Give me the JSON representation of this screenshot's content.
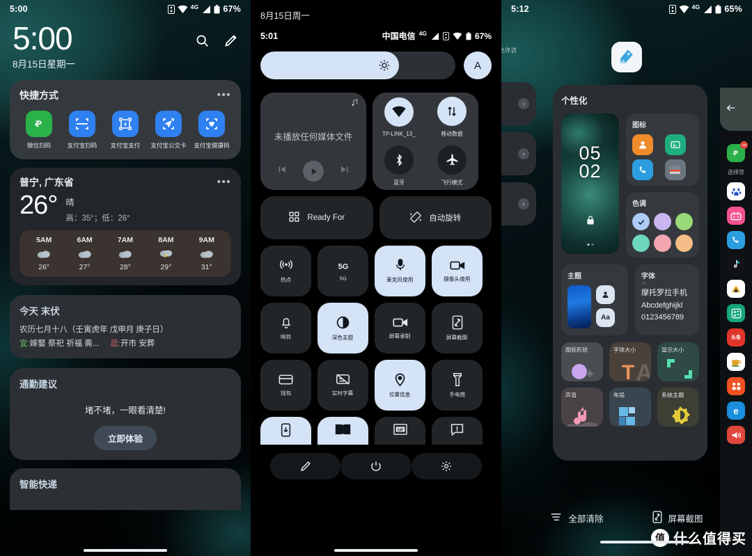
{
  "panel1": {
    "name": "lockscreen-at-a-glance",
    "status": {
      "time": "5:00",
      "battery": "67%",
      "network": "4G"
    },
    "clock": {
      "time": "5:00",
      "date": "8月15日星期一"
    },
    "actions": {
      "search": "search-icon",
      "edit": "edit-icon"
    },
    "shortcuts": {
      "title": "快捷方式",
      "menu": "•••",
      "items": [
        {
          "label": "微信扫码",
          "color": "#2bb14a",
          "icon": "wechat-scan-icon"
        },
        {
          "label": "支付宝扫码",
          "color": "#2f80f0",
          "icon": "alipay-scan-icon"
        },
        {
          "label": "支付宝支付",
          "color": "#2f80f0",
          "icon": "alipay-pay-icon"
        },
        {
          "label": "支付宝公交卡",
          "color": "#2f80f0",
          "icon": "alipay-transit-icon"
        },
        {
          "label": "支付宝健康码",
          "color": "#2f80f0",
          "icon": "alipay-health-icon"
        }
      ]
    },
    "weather": {
      "location": "普宁, 广东省",
      "menu": "•••",
      "temp": "26°",
      "condition": "晴",
      "highlow": "高：35°；低：26°",
      "hours": [
        {
          "time": "5AM",
          "icon": "cloud",
          "temp": "26°"
        },
        {
          "time": "6AM",
          "icon": "cloud",
          "temp": "27°"
        },
        {
          "time": "7AM",
          "icon": "cloud",
          "temp": "28°"
        },
        {
          "time": "8AM",
          "icon": "thunder",
          "temp": "29°"
        },
        {
          "time": "9AM",
          "icon": "cloud",
          "temp": "31°"
        }
      ]
    },
    "almanac": {
      "title": "今天 末伏",
      "lunar": "农历七月十八（壬寅虎年 戊申月 庚子日）",
      "yi_label": "宜:",
      "yi_text": "嫁娶 祭祀 祈福 斋...",
      "ji_label": "忌:",
      "ji_text": "开市 安葬"
    },
    "commute": {
      "title": "通勤建议",
      "text": "堵不堵，一眼看清楚!",
      "button": "立即体验"
    },
    "express": {
      "title": "智能快递"
    }
  },
  "panel2": {
    "name": "quick-settings-shade",
    "date": "8月15日周一",
    "status": {
      "time": "5:01",
      "carrier": "中国电信",
      "network": "4G",
      "battery": "67%"
    },
    "brightness": {
      "value": 71,
      "auto_label": "A"
    },
    "media": {
      "text": "未播放任何媒体文件",
      "prev": "previous-icon",
      "play": "play-icon",
      "next": "next-icon"
    },
    "toggles": [
      {
        "label": "TP-LINK_13_",
        "icon": "wifi-icon",
        "on": true
      },
      {
        "label": "移动数据",
        "icon": "mobile-data-icon",
        "on": true
      },
      {
        "label": "蓝牙",
        "icon": "bluetooth-icon",
        "on": false
      },
      {
        "label": "飞行模式",
        "icon": "airplane-icon",
        "on": false
      }
    ],
    "wide_tiles": [
      {
        "label": "Ready For",
        "icon": "grid-icon"
      },
      {
        "label": "自动旋转",
        "icon": "auto-rotate-icon"
      }
    ],
    "tiles": [
      {
        "label": "热点",
        "icon": "hotspot-icon",
        "active": false
      },
      {
        "label": "5G",
        "icon": "5g-icon",
        "active": false
      },
      {
        "label": "麦克风使用",
        "icon": "microphone-icon",
        "active": true
      },
      {
        "label": "摄像头使用",
        "icon": "camera-icon",
        "active": true
      },
      {
        "label": "响铃",
        "icon": "bell-icon",
        "active": false
      },
      {
        "label": "深色主题",
        "icon": "dark-theme-icon",
        "active": true
      },
      {
        "label": "屏幕录制",
        "icon": "screen-record-icon",
        "active": false
      },
      {
        "label": "屏幕截图",
        "icon": "screenshot-icon",
        "active": false
      },
      {
        "label": "钱包",
        "icon": "wallet-icon",
        "active": false
      },
      {
        "label": "实时字幕",
        "icon": "live-caption-off-icon",
        "active": false
      },
      {
        "label": "位置信息",
        "icon": "location-icon",
        "active": true
      },
      {
        "label": "手电筒",
        "icon": "flashlight-icon",
        "active": false
      }
    ],
    "tiles_clipped": [
      {
        "icon": "download-phone-icon",
        "active": true
      },
      {
        "icon": "dolby-icon",
        "active": true
      },
      {
        "icon": "gif-icon",
        "active": false
      },
      {
        "icon": "alert-message-icon",
        "active": false
      }
    ],
    "footer": [
      {
        "icon": "edit-icon"
      },
      {
        "icon": "power-icon"
      },
      {
        "icon": "gear-icon"
      }
    ]
  },
  "panel3": {
    "name": "personalization-home",
    "status": {
      "time": "5:12",
      "battery": "65%",
      "network": "4G"
    },
    "app_icon": "personalize-app-icon",
    "card": {
      "title": "个性化",
      "wallpaper": {
        "time_line1": "05",
        "time_line2": "02",
        "lock": "lock-icon"
      },
      "icons_card": {
        "title": "图标",
        "items": [
          {
            "name": "contacts-icon",
            "color": "#f08c2a"
          },
          {
            "name": "messages-icon",
            "color": "#1fae7f"
          },
          {
            "name": "phone-icon",
            "color": "#2c9ee0"
          },
          {
            "name": "wallet-icon",
            "color": "#6a7580"
          }
        ]
      },
      "hue_card": {
        "title": "色调",
        "colors": [
          "#aecbf5",
          "#c9b6f0",
          "#9ada78",
          "#6ed7c0",
          "#f2a6b0",
          "#f5bd87"
        ],
        "selected": 0
      },
      "theme_card": {
        "title": "主题",
        "badges": [
          "person-icon",
          "Aa"
        ]
      },
      "font_card": {
        "title": "字体",
        "lines": [
          "摩托罗拉手机",
          "Abcdefghijkl",
          "0123456789"
        ]
      },
      "tiles": [
        {
          "label": "图标形状",
          "color": "#4a4e52",
          "accent": "#c9a4ef"
        },
        {
          "label": "字体大小",
          "color": "#4a413a",
          "accent": "#e7915a"
        },
        {
          "label": "显示大小",
          "color": "#2f4a45",
          "accent": "#55e0b0"
        },
        {
          "label": "声音",
          "color": "#4a4346",
          "accent": "#f098b8"
        },
        {
          "label": "布局",
          "color": "#39454f",
          "accent": "#67b9e8"
        },
        {
          "label": "系统主题",
          "color": "#3d3f34",
          "accent": "#e3c93c"
        }
      ]
    },
    "side_left": {
      "text": "的存储。\n允许访问",
      "chevron": "chevron-right-icon"
    },
    "side_right": {
      "back": "back-arrow-icon",
      "label": "选择您",
      "pinned_app": {
        "name": "wechat-icon",
        "color": "#2bb14a"
      },
      "apps": [
        {
          "name": "baidu-icon",
          "color": "#ffffff",
          "glyph": "🐾",
          "fg": "#2857c9"
        },
        {
          "name": "bilibili-icon",
          "color": "#f5538f",
          "glyph": "bili",
          "fg": "#ffffff"
        },
        {
          "name": "phone-icon",
          "color": "#2c9ee0",
          "glyph": "✆",
          "fg": "#ffffff"
        },
        {
          "name": "tiktok-icon",
          "color": "#111318",
          "glyph": "♪",
          "fg": "#ffffff"
        },
        {
          "name": "meituan-icon",
          "color": "#ffffff",
          "glyph": "▲",
          "fg": "#f0b323"
        },
        {
          "name": "calculator-icon",
          "color": "#17a67c",
          "glyph": "÷",
          "fg": "#ffffff"
        },
        {
          "name": "toutiao-icon",
          "color": "#e0352b",
          "glyph": "头条",
          "fg": "#ffffff"
        },
        {
          "name": "tea-app-icon",
          "color": "#ffffff",
          "glyph": "☕",
          "fg": "#e0a020"
        },
        {
          "name": "kuaishou-icon",
          "color": "#f05022",
          "glyph": "快",
          "fg": "#ffffff"
        },
        {
          "name": "edge-icon",
          "color": "#1a8fe0",
          "glyph": "e",
          "fg": "#ffffff"
        },
        {
          "name": "audio-icon",
          "color": "#e0473c",
          "glyph": "◀",
          "fg": "#ffffff"
        }
      ]
    },
    "footer": [
      {
        "label": "全部清除",
        "icon": "clear-all-icon"
      },
      {
        "label": "屏幕截图",
        "icon": "screenshot-icon"
      }
    ],
    "watermark": {
      "mark": "值",
      "text": "什么值得买"
    }
  }
}
